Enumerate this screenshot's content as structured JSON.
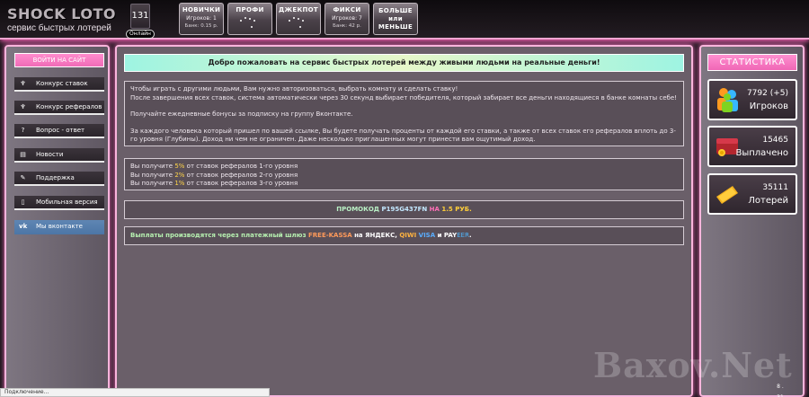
{
  "logo": {
    "title": "SHOCK LOTO",
    "subtitle": "сервис быстрых лотерей"
  },
  "online": {
    "count": "131",
    "label": "Онлайн"
  },
  "game_tabs": [
    {
      "name": "НОВИЧКИ",
      "line1": "Игроков: 1",
      "line2": "Банк: 0.15 р."
    },
    {
      "name": "ПРОФИ",
      "line1": "",
      "line2": ""
    },
    {
      "name": "ДЖЕКПОТ",
      "line1": "",
      "line2": ""
    },
    {
      "name": "ФИКСИ",
      "line1": "Игроков: 7",
      "line2": "Банк: 42 р."
    }
  ],
  "more_tab": {
    "l1": "БОЛЬШЕ",
    "l2": "или",
    "l3": "МЕНЬШЕ"
  },
  "nav": {
    "login": "ВОЙТИ НА САЙТ",
    "items": [
      {
        "label": "Конкурс ставок",
        "icon": "trophy-icon"
      },
      {
        "label": "Конкурс рефералов",
        "icon": "trophy-icon"
      },
      {
        "label": "Вопрос - ответ",
        "icon": "question-icon"
      },
      {
        "label": "Новости",
        "icon": "news-icon"
      },
      {
        "label": "Поддержка",
        "icon": "pencil-icon"
      },
      {
        "label": "Мобильная версия",
        "icon": "mobile-icon"
      },
      {
        "label": "Мы вконтакте",
        "icon": "vk-icon"
      }
    ]
  },
  "welcome": "Добро пожаловать на сервис быстрых лотерей между живыми людьми на реальные деньги!",
  "intro": {
    "p1": "Чтобы играть с другими людьми, Вам нужно авторизоваться, выбрать комнату и сделать ставку!",
    "p2": "После завершения всех ставок, система автоматически через 30 секунд выбирает победителя, который забирает все деньги находящиеся в банке комнаты себе!",
    "p3": "Получайте ежедневные бонусы за подписку на группу Вконтакте.",
    "p4": "За каждого человека который пришел по вашей ссылке, Вы будете получать проценты от каждой его ставки, а также от всех ставок его рефералов вплоть до 3-го уровня (Глубины). Доход ни чем не ограничен. Даже несколько приглашенных могут принести вам ощутимый доход."
  },
  "referral": [
    {
      "pre": "Вы получите ",
      "pct": "5%",
      "post": " от ставок рефералов 1-го уровня"
    },
    {
      "pre": "Вы получите ",
      "pct": "2%",
      "post": " от ставок рефералов 2-го уровня"
    },
    {
      "pre": "Вы получите ",
      "pct": "1%",
      "post": " от ставок рефералов 3-го уровня"
    }
  ],
  "promo": {
    "label": "ПРОМОКОД ",
    "code": "P195G437FN",
    "on": " НА ",
    "amount": "1.5 РУБ."
  },
  "payout": {
    "pre": "Выплаты производятся через платежный шлюз ",
    "kassa": "FREE-KASSA",
    "on": " на ",
    "yandex": "ЯНДЕКС",
    "comma1": ", ",
    "qiwi": "QIWI",
    "visa": " VISA",
    "and": " и ",
    "payeer": "PAY",
    "payeer2": "EER",
    "end": "."
  },
  "stats": {
    "title": "СТАТИСТИКА",
    "players": {
      "value": "7792 (+5)",
      "label": "Игроков"
    },
    "paid": {
      "value": "15465",
      "label": "Выплачено"
    },
    "lotteries": {
      "value": "35111",
      "label": "Лотерей"
    }
  },
  "status_bar": "Подключение...",
  "watermark": "Baxov.Net",
  "corner": "8 . 31",
  "colors": {
    "accent_pink": "#ff73c6",
    "welcome_mint": "#9ef4e2",
    "panel_bg": "#594f58"
  }
}
